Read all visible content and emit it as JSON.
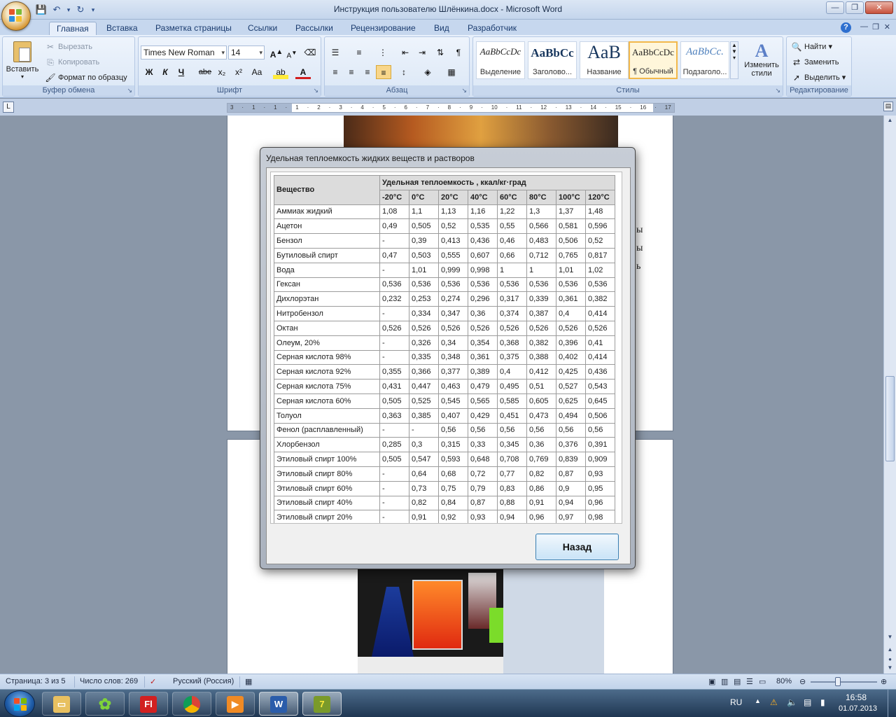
{
  "window": {
    "title": "Инструкция пользователю Шлёнкина.docx - Microsoft Word",
    "controls": {
      "minimize": "—",
      "maximize": "❐",
      "close": "✕"
    }
  },
  "qat": {
    "save": "💾",
    "undo": "↶",
    "redo": "↻",
    "more": "▾"
  },
  "ribbon": {
    "tabs": [
      "Главная",
      "Вставка",
      "Разметка страницы",
      "Ссылки",
      "Рассылки",
      "Рецензирование",
      "Вид",
      "Разработчик"
    ],
    "active_tab": "Главная",
    "clipboard": {
      "paste": "Вставить",
      "cut": "Вырезать",
      "copy": "Копировать",
      "format_painter": "Формат по образцу",
      "label": "Буфер обмена"
    },
    "font": {
      "name": "Times New Roman",
      "size": "14",
      "label": "Шрифт",
      "buttons": [
        "Ж",
        "К",
        "Ч",
        "abe",
        "x₂",
        "x²",
        "Aa"
      ]
    },
    "paragraph": {
      "label": "Абзац"
    },
    "styles": {
      "label": "Стилы",
      "items": [
        {
          "sample": "AaBbCcDc",
          "name": "Выделение"
        },
        {
          "sample": "AaBbCc",
          "name": "Заголово..."
        },
        {
          "sample": "AaB",
          "name": "Название"
        },
        {
          "sample": "AaBbCcDc",
          "name": "¶ Обычный"
        },
        {
          "sample": "AaBbCc.",
          "name": "Подзаголо..."
        }
      ],
      "change": "Изменить стили"
    },
    "editing": {
      "find": "Найти",
      "replace": "Заменить",
      "select": "Выделить",
      "label": "Редактирование"
    }
  },
  "ruler": {
    "ticks": [
      "3",
      "·",
      "1",
      "·",
      "1",
      "·",
      "1",
      "·",
      "2",
      "·",
      "3",
      "·",
      "4",
      "·",
      "5",
      "·",
      "6",
      "·",
      "7",
      "·",
      "8",
      "·",
      "9",
      "·",
      "10",
      "·",
      "11",
      "·",
      "12",
      "·",
      "13",
      "·",
      "14",
      "·",
      "15",
      "·",
      "16",
      "·",
      "17"
    ]
  },
  "dialog": {
    "title": "Удельная теплоемкость жидких веществ и растворов",
    "header": {
      "substance": "Вещество",
      "group": "Удельная теплоемкость , ккал/кг·град"
    },
    "temperatures": [
      "-20°C",
      "0°C",
      "20°C",
      "40°C",
      "60°C",
      "80°C",
      "100°C",
      "120°C"
    ],
    "rows": [
      {
        "name": "Аммиак жидкий",
        "values": [
          "1,08",
          "1,1",
          "1,13",
          "1,16",
          "1,22",
          "1,3",
          "1,37",
          "1,48"
        ]
      },
      {
        "name": "Ацетон",
        "values": [
          "0,49",
          "0,505",
          "0,52",
          "0,535",
          "0,55",
          "0,566",
          "0,581",
          "0,596"
        ]
      },
      {
        "name": "Бензол",
        "values": [
          "-",
          "0,39",
          "0,413",
          "0,436",
          "0,46",
          "0,483",
          "0,506",
          "0,52"
        ]
      },
      {
        "name": "Бутиловый спирт",
        "values": [
          "0,47",
          "0,503",
          "0,555",
          "0,607",
          "0,66",
          "0,712",
          "0,765",
          "0,817"
        ]
      },
      {
        "name": "Вода",
        "values": [
          "-",
          "1,01",
          "0,999",
          "0,998",
          "1",
          "1",
          "1,01",
          "1,02"
        ]
      },
      {
        "name": "Гексан",
        "values": [
          "0,536",
          "0,536",
          "0,536",
          "0,536",
          "0,536",
          "0,536",
          "0,536",
          "0,536"
        ]
      },
      {
        "name": "Дихлорэтан",
        "values": [
          "0,232",
          "0,253",
          "0,274",
          "0,296",
          "0,317",
          "0,339",
          "0,361",
          "0,382"
        ]
      },
      {
        "name": "Нитробензол",
        "values": [
          "-",
          "0,334",
          "0,347",
          "0,36",
          "0,374",
          "0,387",
          "0,4",
          "0,414"
        ]
      },
      {
        "name": "Октан",
        "values": [
          "0,526",
          "0,526",
          "0,526",
          "0,526",
          "0,526",
          "0,526",
          "0,526",
          "0,526"
        ]
      },
      {
        "name": "Олеум, 20%",
        "values": [
          "-",
          "0,326",
          "0,34",
          "0,354",
          "0,368",
          "0,382",
          "0,396",
          "0,41"
        ]
      },
      {
        "name": "Серная кислота 98%",
        "values": [
          "-",
          "0,335",
          "0,348",
          "0,361",
          "0,375",
          "0,388",
          "0,402",
          "0,414"
        ]
      },
      {
        "name": "Серная кислота 92%",
        "values": [
          "0,355",
          "0,366",
          "0,377",
          "0,389",
          "0,4",
          "0,412",
          "0,425",
          "0,436"
        ]
      },
      {
        "name": "Серная кислота 75%",
        "values": [
          "0,431",
          "0,447",
          "0,463",
          "0,479",
          "0,495",
          "0,51",
          "0,527",
          "0,543"
        ]
      },
      {
        "name": "Серная кислота 60%",
        "values": [
          "0,505",
          "0,525",
          "0,545",
          "0,565",
          "0,585",
          "0,605",
          "0,625",
          "0,645"
        ]
      },
      {
        "name": "Толуол",
        "values": [
          "0,363",
          "0,385",
          "0,407",
          "0,429",
          "0,451",
          "0,473",
          "0,494",
          "0,506"
        ]
      },
      {
        "name": "Фенол (расплавленный)",
        "values": [
          "-",
          "-",
          "0,56",
          "0,56",
          "0,56",
          "0,56",
          "0,56",
          "0,56"
        ]
      },
      {
        "name": "Хлорбензол",
        "values": [
          "0,285",
          "0,3",
          "0,315",
          "0,33",
          "0,345",
          "0,36",
          "0,376",
          "0,391"
        ]
      },
      {
        "name": "Этиловый спирт 100%",
        "values": [
          "0,505",
          "0,547",
          "0,593",
          "0,648",
          "0,708",
          "0,769",
          "0,839",
          "0,909"
        ]
      },
      {
        "name": "Этиловый спирт 80%",
        "values": [
          "-",
          "0,64",
          "0,68",
          "0,72",
          "0,77",
          "0,82",
          "0,87",
          "0,93"
        ]
      },
      {
        "name": "Этиловый спирт 60%",
        "values": [
          "-",
          "0,73",
          "0,75",
          "0,79",
          "0,83",
          "0,86",
          "0,9",
          "0,95"
        ]
      },
      {
        "name": "Этиловый спирт 40%",
        "values": [
          "-",
          "0,82",
          "0,84",
          "0,87",
          "0,88",
          "0,91",
          "0,94",
          "0,96"
        ]
      },
      {
        "name": "Этиловый спирт 20%",
        "values": [
          "-",
          "0,91",
          "0,92",
          "0,93",
          "0,94",
          "0,96",
          "0,97",
          "0,98"
        ]
      }
    ],
    "back_button": "Назад"
  },
  "doc_fragments": {
    "text_1": "ы",
    "text_2": "ы",
    "text_3": "ь"
  },
  "statusbar": {
    "page": "Страница: 3 из 5",
    "words": "Число слов: 269",
    "language": "Русский (Россия)",
    "zoom": "80%"
  },
  "taskbar": {
    "apps": [
      "explorer",
      "icq",
      "flashget",
      "chrome",
      "media-player",
      "word",
      "tool"
    ],
    "lang": "RU",
    "time": "16:58",
    "date": "01.07.2013"
  }
}
